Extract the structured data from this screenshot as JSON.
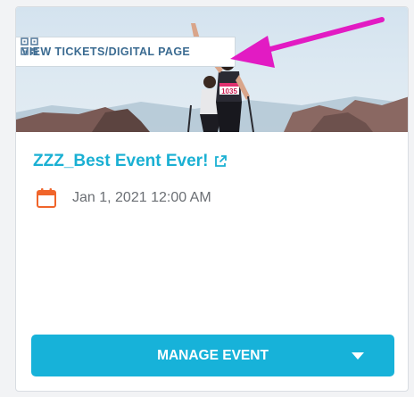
{
  "card": {
    "tickets_badge_label": "VIEW TICKETS/DIGITAL PAGE",
    "event_title": "ZZZ_Best Event Ever!",
    "event_date": "Jan 1, 2021 12:00 AM",
    "manage_button_label": "MANAGE EVENT",
    "hero_bib_number": "1035"
  },
  "icons": {
    "qr": "qr-code-icon",
    "external_link": "external-link-icon",
    "calendar": "calendar-icon",
    "dropdown": "chevron-down-icon"
  },
  "colors": {
    "accent": "#1ab0d3",
    "button": "#17b2d9",
    "badge_text": "#3b6b91",
    "calendar_icon": "#f0652b",
    "annotation_arrow": "#e21bc3"
  }
}
